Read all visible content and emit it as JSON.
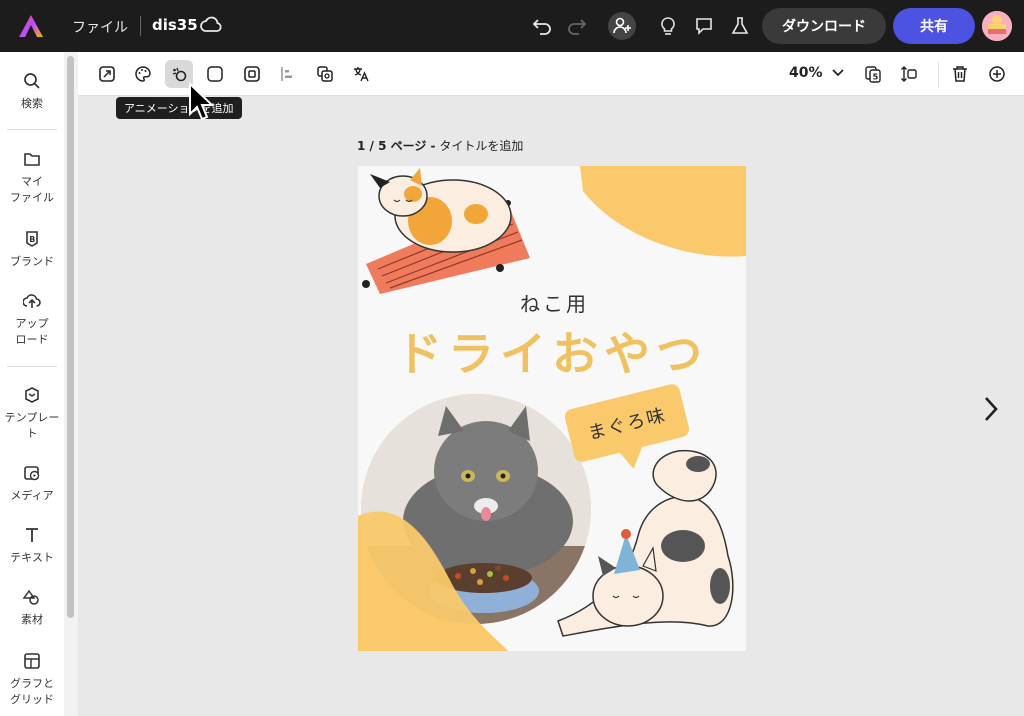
{
  "topbar": {
    "file_menu": "ファイル",
    "doc_name": "dis35",
    "download_label": "ダウンロード",
    "share_label": "共有",
    "colors": {
      "background": "#1c1c1c",
      "share": "#4b53e0"
    }
  },
  "sidebar": {
    "items": [
      {
        "label": "検索",
        "icon": "search-icon"
      },
      {
        "label": "マイ\nファイル",
        "icon": "folder-icon"
      },
      {
        "label": "ブランド",
        "icon": "brand-icon"
      },
      {
        "label": "アップ\nロード",
        "icon": "upload-icon"
      },
      {
        "label": "テンプレー\nト",
        "icon": "template-icon"
      },
      {
        "label": "メディア",
        "icon": "media-icon"
      },
      {
        "label": "テキスト",
        "icon": "text-icon"
      },
      {
        "label": "素材",
        "icon": "elements-icon"
      },
      {
        "label": "グラフと\nグリッド",
        "icon": "grid-icon"
      }
    ]
  },
  "toolbar": {
    "zoom": "40%",
    "tooltip": "アニメーションを追加"
  },
  "canvas": {
    "page_counter": "1 / 5 ページ -",
    "page_title_placeholder": "タイトルを追加",
    "poster": {
      "subtitle": "ねこ用",
      "title": "ドライおやつ",
      "flavor": "まぐろ味",
      "accent": "#f9c96b"
    }
  }
}
